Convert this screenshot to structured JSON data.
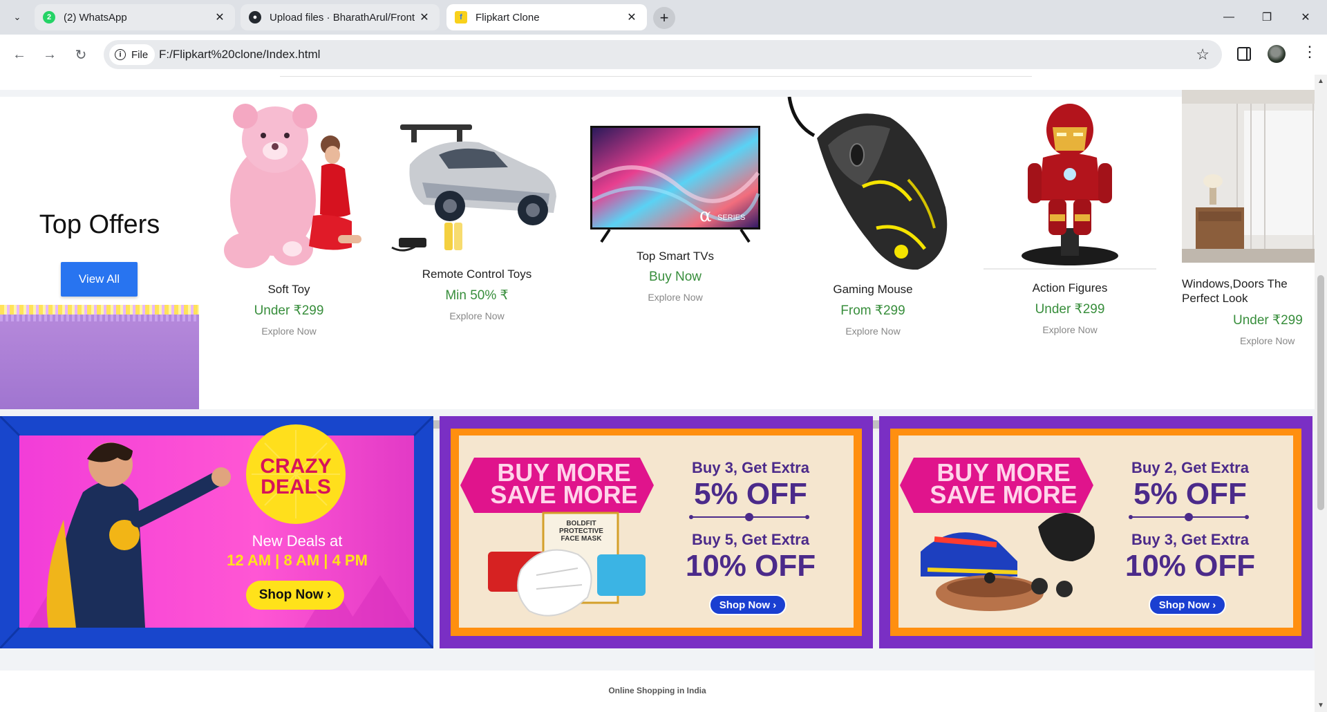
{
  "browser": {
    "tabs": [
      {
        "title": "(2) WhatsApp",
        "badge": "2",
        "favicon": "whatsapp-icon"
      },
      {
        "title": "Upload files · BharathArul/Front",
        "favicon": "github-icon"
      },
      {
        "title": "Flipkart Clone",
        "favicon": "flipkart-icon",
        "active": true
      }
    ],
    "new_tab": "+",
    "file_chip": "File",
    "url": "F:/Flipkart%20clone/Index.html"
  },
  "offers": {
    "title": "Top Offers",
    "view_all": "View All",
    "products": [
      {
        "name": "Soft Toy",
        "price": "Under ₹299",
        "explore": "Explore Now"
      },
      {
        "name": "Remote Control Toys",
        "price": "Min 50% ₹",
        "explore": "Explore Now"
      },
      {
        "name": "Top Smart TVs",
        "price": "Buy Now",
        "explore": "Explore Now"
      },
      {
        "name": "Gaming Mouse",
        "price": "From ₹299",
        "explore": "Explore Now"
      },
      {
        "name": "Action Figures",
        "price": "Under ₹299",
        "explore": "Explore Now"
      },
      {
        "name": "Windows,Doors The Perfect Look",
        "price": "Under ₹299",
        "explore": "Explore Now"
      }
    ],
    "tv_badge": "α",
    "tv_series": "SERIES"
  },
  "banners": [
    {
      "headline_top": "CRAZY",
      "headline_bottom": "DEALS",
      "subtitle": "New Deals at",
      "times": "12 AM | 8 AM | 4 PM",
      "cta": "Shop Now ›"
    },
    {
      "title_top": "BUY MORE",
      "title_bottom": "SAVE MORE",
      "offer1_label": "Buy 3, Get Extra",
      "offer1_value": "5% OFF",
      "offer2_label": "Buy 5, Get Extra",
      "offer2_value": "10% OFF",
      "cta": "Shop Now ›",
      "box_brand": "BOLDFIT",
      "box_text": "PROTECTIVE FACE MASK"
    },
    {
      "title_top": "BUY MORE",
      "title_bottom": "SAVE MORE",
      "offer1_label": "Buy 2, Get Extra",
      "offer1_value": "5% OFF",
      "offer2_label": "Buy 3, Get Extra",
      "offer2_value": "10% OFF",
      "cta": "Shop Now ›"
    }
  ],
  "footer": {
    "text": "Online Shopping in India"
  },
  "colors": {
    "primary": "#2874f0",
    "price_green": "#388e3c",
    "banner_purple": "#7a2fc4",
    "banner_blue": "#1847c9"
  }
}
